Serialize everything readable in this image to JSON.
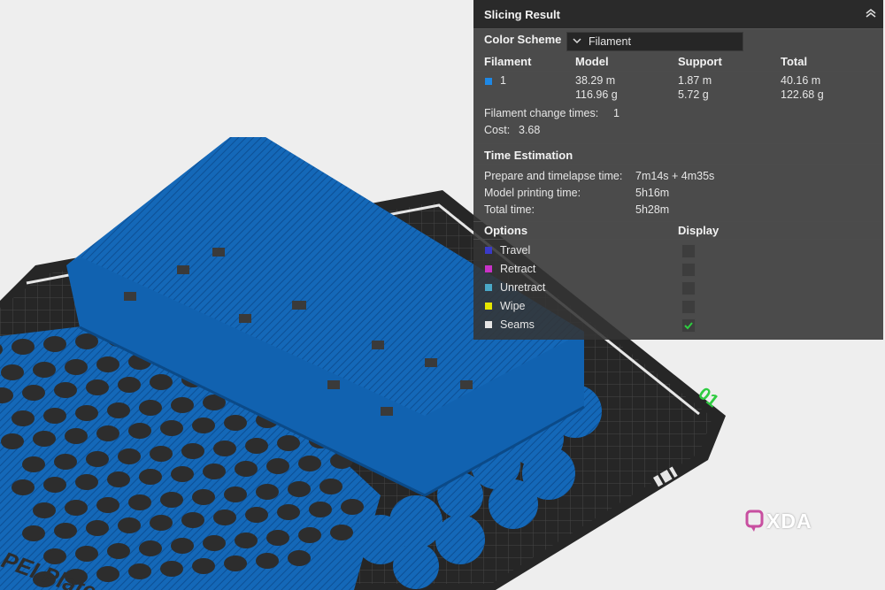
{
  "panel": {
    "title": "Slicing Result",
    "color_scheme_label": "Color Scheme",
    "color_scheme_value": "Filament",
    "columns": [
      "Filament",
      "Model",
      "Support",
      "Total"
    ],
    "filament_row": {
      "id": "1",
      "swatch_color": "#1e88e5",
      "model_length": "38.29 m",
      "model_weight": "116.96 g",
      "support_length": "1.87 m",
      "support_weight": "5.72 g",
      "total_length": "40.16 m",
      "total_weight": "122.68 g"
    },
    "change_times_label": "Filament change times:",
    "change_times_value": "1",
    "cost_label": "Cost:",
    "cost_value": "3.68",
    "time_heading": "Time Estimation",
    "prepare_label": "Prepare and timelapse time:",
    "prepare_value": "7m14s + 4m35s",
    "model_time_label": "Model printing time:",
    "model_time_value": "5h16m",
    "total_time_label": "Total time:",
    "total_time_value": "5h28m",
    "options_heading": "Options",
    "display_heading": "Display",
    "options": [
      {
        "label": "Travel",
        "color": "#3a3ac8",
        "checked": false
      },
      {
        "label": "Retract",
        "color": "#c832c8",
        "checked": false
      },
      {
        "label": "Unretract",
        "color": "#4aa8c8",
        "checked": false
      },
      {
        "label": "Wipe",
        "color": "#e6e600",
        "checked": false
      },
      {
        "label": "Seams",
        "color": "#e6e6e6",
        "checked": true
      }
    ]
  },
  "plate": {
    "label": "PEI Plate",
    "number": "01"
  },
  "watermark": "XDA",
  "colors": {
    "print_blue": "#1466b4",
    "plate_dark": "#2b2b2b",
    "accent_green": "#2ecc40"
  }
}
